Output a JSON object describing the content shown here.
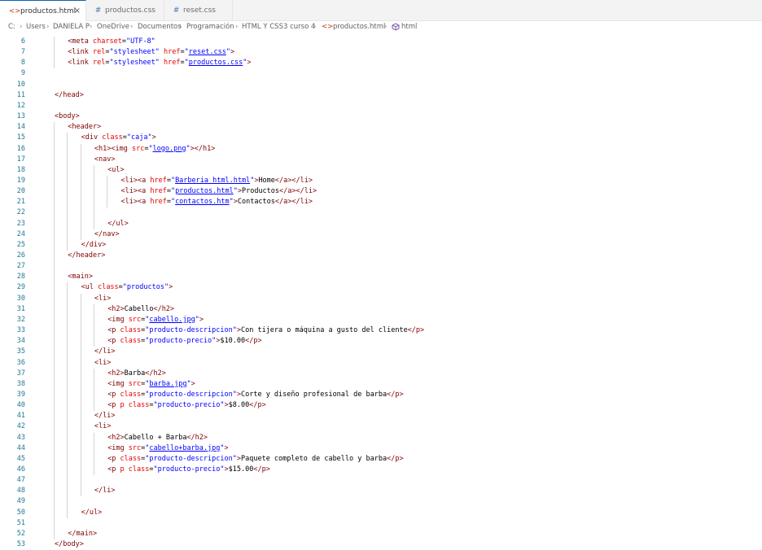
{
  "tabs": [
    {
      "label": "productos.html",
      "icon": "html-file-icon",
      "active": true,
      "close": "×"
    },
    {
      "label": "productos.css",
      "icon": "css-file-icon",
      "active": false
    },
    {
      "label": "reset.css",
      "icon": "css-file-icon",
      "active": false
    }
  ],
  "breadcrumb": [
    "C:",
    "Users",
    "DANIELA P",
    "OneDrive",
    "Documentos",
    "Programación",
    "HTML Y CSS3 curso 4",
    "productos.html",
    "html"
  ],
  "code_lines": [
    {
      "n": "6",
      "i": 1,
      "t": [
        [
          "tag",
          "<meta "
        ],
        [
          "attr",
          "charset"
        ],
        [
          "txt",
          "="
        ],
        [
          "val",
          "\"UTF-8\""
        ]
      ]
    },
    {
      "n": "7",
      "i": 1,
      "t": [
        [
          "tag",
          "<link "
        ],
        [
          "attr",
          "rel"
        ],
        [
          "txt",
          "="
        ],
        [
          "val",
          "\"stylesheet\""
        ],
        [
          "attr",
          " href"
        ],
        [
          "txt",
          "="
        ],
        [
          "val",
          "\""
        ],
        [
          "link",
          "reset.css"
        ],
        [
          "val",
          "\""
        ],
        [
          "tag",
          ">"
        ]
      ]
    },
    {
      "n": "8",
      "i": 1,
      "t": [
        [
          "tag",
          "<link "
        ],
        [
          "attr",
          "rel"
        ],
        [
          "txt",
          "="
        ],
        [
          "val",
          "\"stylesheet\""
        ],
        [
          "attr",
          " href"
        ],
        [
          "txt",
          "="
        ],
        [
          "val",
          "\""
        ],
        [
          "link",
          "productos.css"
        ],
        [
          "val",
          "\""
        ],
        [
          "tag",
          ">"
        ]
      ]
    },
    {
      "n": "9",
      "i": 0,
      "t": []
    },
    {
      "n": "10",
      "i": 0,
      "t": []
    },
    {
      "n": "11",
      "i": 0,
      "t": [
        [
          "tag",
          "</head>"
        ]
      ]
    },
    {
      "n": "12",
      "i": 0,
      "t": []
    },
    {
      "n": "13",
      "i": 0,
      "t": [
        [
          "tag",
          "<body>"
        ]
      ]
    },
    {
      "n": "14",
      "i": 1,
      "t": [
        [
          "tag",
          "<header>"
        ]
      ]
    },
    {
      "n": "15",
      "i": 2,
      "t": [
        [
          "tag",
          "<div "
        ],
        [
          "attr",
          "class"
        ],
        [
          "txt",
          "="
        ],
        [
          "val",
          "\"caja\""
        ],
        [
          "tag",
          ">"
        ]
      ]
    },
    {
      "n": "16",
      "i": 3,
      "t": [
        [
          "tag",
          "<h1><img "
        ],
        [
          "attr",
          "src"
        ],
        [
          "txt",
          "="
        ],
        [
          "val",
          "\""
        ],
        [
          "link",
          "logo.png"
        ],
        [
          "val",
          "\""
        ],
        [
          "tag",
          "></h1>"
        ]
      ]
    },
    {
      "n": "17",
      "i": 3,
      "t": [
        [
          "tag",
          "<nav>"
        ]
      ]
    },
    {
      "n": "18",
      "i": 4,
      "t": [
        [
          "tag",
          "<ul>"
        ]
      ]
    },
    {
      "n": "19",
      "i": 5,
      "t": [
        [
          "tag",
          "<li><a "
        ],
        [
          "attr",
          "href"
        ],
        [
          "txt",
          "="
        ],
        [
          "val",
          "\""
        ],
        [
          "link",
          "Barberia_html.html"
        ],
        [
          "val",
          "\""
        ],
        [
          "tag",
          ">"
        ],
        [
          "txt",
          "Home"
        ],
        [
          "tag",
          "</a></li>"
        ]
      ]
    },
    {
      "n": "20",
      "i": 5,
      "t": [
        [
          "tag",
          "<li><a "
        ],
        [
          "attr",
          "href"
        ],
        [
          "txt",
          "="
        ],
        [
          "val",
          "\""
        ],
        [
          "link",
          "productos.html"
        ],
        [
          "val",
          "\""
        ],
        [
          "tag",
          ">"
        ],
        [
          "txt",
          "Productos"
        ],
        [
          "tag",
          "</a></li>"
        ]
      ]
    },
    {
      "n": "21",
      "i": 5,
      "t": [
        [
          "tag",
          "<li><a "
        ],
        [
          "attr",
          "href"
        ],
        [
          "txt",
          "="
        ],
        [
          "val",
          "\""
        ],
        [
          "link",
          "contactos.htm"
        ],
        [
          "val",
          "\""
        ],
        [
          "tag",
          ">"
        ],
        [
          "txt",
          "Contactos"
        ],
        [
          "tag",
          "</a></li>"
        ]
      ]
    },
    {
      "n": "22",
      "i": 0,
      "t": []
    },
    {
      "n": "23",
      "i": 4,
      "t": [
        [
          "tag",
          "</ul>"
        ]
      ]
    },
    {
      "n": "24",
      "i": 3,
      "t": [
        [
          "tag",
          "</nav>"
        ]
      ]
    },
    {
      "n": "25",
      "i": 2,
      "t": [
        [
          "tag",
          "</div>"
        ]
      ]
    },
    {
      "n": "26",
      "i": 1,
      "t": [
        [
          "tag",
          "</header>"
        ]
      ]
    },
    {
      "n": "27",
      "i": 0,
      "t": []
    },
    {
      "n": "28",
      "i": 1,
      "t": [
        [
          "tag",
          "<main>"
        ]
      ]
    },
    {
      "n": "29",
      "i": 2,
      "t": [
        [
          "tag",
          "<ul "
        ],
        [
          "attr",
          "class"
        ],
        [
          "txt",
          "="
        ],
        [
          "val",
          "\"productos\""
        ],
        [
          "tag",
          ">"
        ]
      ]
    },
    {
      "n": "30",
      "i": 3,
      "t": [
        [
          "tag",
          "<li>"
        ]
      ]
    },
    {
      "n": "31",
      "i": 4,
      "t": [
        [
          "tag",
          "<h2>"
        ],
        [
          "txt",
          "Cabello"
        ],
        [
          "tag",
          "</h2>"
        ]
      ]
    },
    {
      "n": "32",
      "i": 4,
      "t": [
        [
          "tag",
          "<img "
        ],
        [
          "attr",
          "src"
        ],
        [
          "txt",
          "="
        ],
        [
          "val",
          "\""
        ],
        [
          "link",
          "cabello.jpg"
        ],
        [
          "val",
          "\""
        ],
        [
          "tag",
          ">"
        ]
      ]
    },
    {
      "n": "33",
      "i": 4,
      "t": [
        [
          "tag",
          "<p "
        ],
        [
          "attr",
          "class"
        ],
        [
          "txt",
          "="
        ],
        [
          "val",
          "\"producto-descripcion\""
        ],
        [
          "tag",
          ">"
        ],
        [
          "txt",
          "Con tijera o máquina a gusto del cliente"
        ],
        [
          "tag",
          "</p>"
        ]
      ]
    },
    {
      "n": "34",
      "i": 4,
      "t": [
        [
          "tag",
          "<p "
        ],
        [
          "attr",
          "class"
        ],
        [
          "txt",
          "="
        ],
        [
          "val",
          "\"producto-precio\""
        ],
        [
          "tag",
          ">"
        ],
        [
          "txt",
          "$10.00"
        ],
        [
          "tag",
          "</p>"
        ]
      ]
    },
    {
      "n": "35",
      "i": 3,
      "t": [
        [
          "tag",
          "</li>"
        ]
      ]
    },
    {
      "n": "36",
      "i": 3,
      "t": [
        [
          "tag",
          "<li>"
        ]
      ]
    },
    {
      "n": "37",
      "i": 4,
      "t": [
        [
          "tag",
          "<h2>"
        ],
        [
          "txt",
          "Barba"
        ],
        [
          "tag",
          "</h2>"
        ]
      ]
    },
    {
      "n": "38",
      "i": 4,
      "t": [
        [
          "tag",
          "<img "
        ],
        [
          "attr",
          "src"
        ],
        [
          "txt",
          "="
        ],
        [
          "val",
          "\""
        ],
        [
          "link",
          "barba.jpg"
        ],
        [
          "val",
          "\""
        ],
        [
          "tag",
          ">"
        ]
      ]
    },
    {
      "n": "39",
      "i": 4,
      "t": [
        [
          "tag",
          "<p "
        ],
        [
          "attr",
          "class"
        ],
        [
          "txt",
          "="
        ],
        [
          "val",
          "\"producto-descripcion\""
        ],
        [
          "tag",
          ">"
        ],
        [
          "txt",
          "Corte y diseño profesional de barba"
        ],
        [
          "tag",
          "</p>"
        ]
      ]
    },
    {
      "n": "40",
      "i": 4,
      "t": [
        [
          "tag",
          "<p "
        ],
        [
          "attr",
          "p class"
        ],
        [
          "txt",
          "="
        ],
        [
          "val",
          "\"producto-precio\""
        ],
        [
          "tag",
          ">"
        ],
        [
          "txt",
          "$8.00"
        ],
        [
          "tag",
          "</p>"
        ]
      ]
    },
    {
      "n": "41",
      "i": 3,
      "t": [
        [
          "tag",
          "</li>"
        ]
      ]
    },
    {
      "n": "42",
      "i": 3,
      "t": [
        [
          "tag",
          "<li>"
        ]
      ]
    },
    {
      "n": "43",
      "i": 4,
      "t": [
        [
          "tag",
          "<h2>"
        ],
        [
          "txt",
          "Cabello + Barba"
        ],
        [
          "tag",
          "</h2>"
        ]
      ]
    },
    {
      "n": "44",
      "i": 4,
      "t": [
        [
          "tag",
          "<img "
        ],
        [
          "attr",
          "src"
        ],
        [
          "txt",
          "="
        ],
        [
          "val",
          "\""
        ],
        [
          "link",
          "cabello+barba.jpg"
        ],
        [
          "val",
          "\""
        ],
        [
          "tag",
          ">"
        ]
      ]
    },
    {
      "n": "45",
      "i": 4,
      "t": [
        [
          "tag",
          "<p "
        ],
        [
          "attr",
          "class"
        ],
        [
          "txt",
          "="
        ],
        [
          "val",
          "\"producto-descripcion\""
        ],
        [
          "tag",
          ">"
        ],
        [
          "txt",
          "Paquete completo de cabello y barba"
        ],
        [
          "tag",
          "</p>"
        ]
      ]
    },
    {
      "n": "46",
      "i": 4,
      "t": [
        [
          "tag",
          "<p "
        ],
        [
          "attr",
          "p class"
        ],
        [
          "txt",
          "="
        ],
        [
          "val",
          "\"producto-precio\""
        ],
        [
          "tag",
          ">"
        ],
        [
          "txt",
          "$15.00"
        ],
        [
          "tag",
          "</p>"
        ]
      ]
    },
    {
      "n": "47",
      "i": 0,
      "t": []
    },
    {
      "n": "48",
      "i": 3,
      "t": [
        [
          "tag",
          "</li>"
        ]
      ]
    },
    {
      "n": "49",
      "i": 0,
      "t": []
    },
    {
      "n": "50",
      "i": 2,
      "t": [
        [
          "tag",
          "</ul>"
        ]
      ]
    },
    {
      "n": "51",
      "i": 0,
      "t": []
    },
    {
      "n": "52",
      "i": 1,
      "t": [
        [
          "tag",
          "</main>"
        ]
      ]
    },
    {
      "n": "53",
      "i": 0,
      "t": [
        [
          "tag",
          "</body>"
        ]
      ]
    }
  ]
}
